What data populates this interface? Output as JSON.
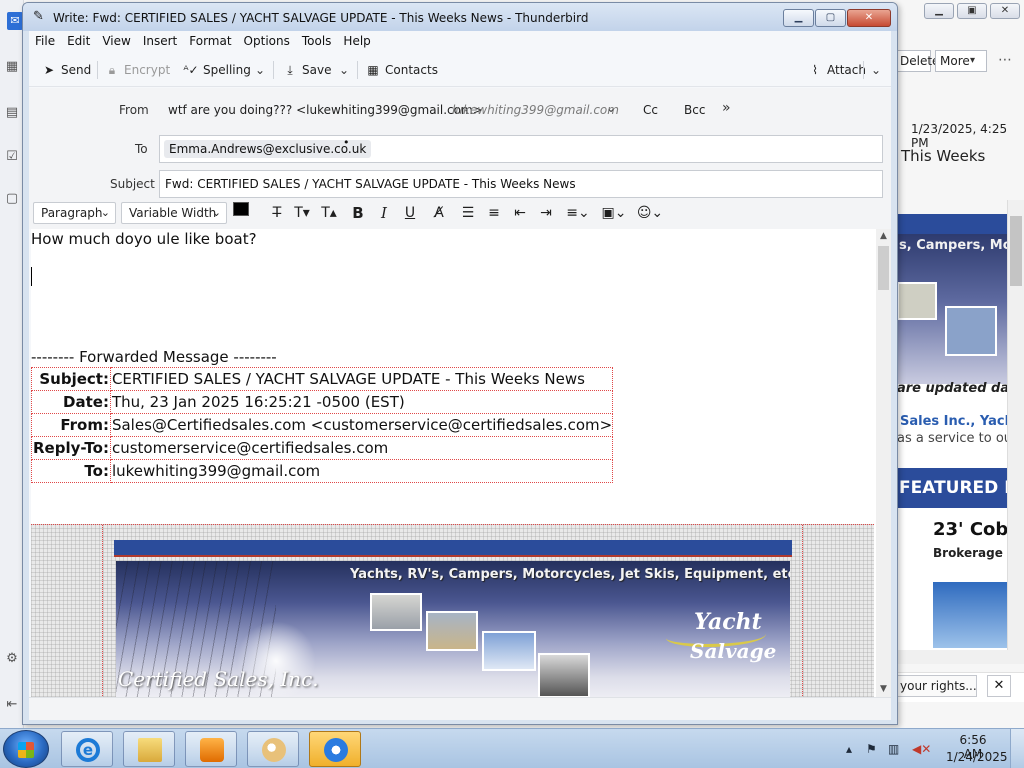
{
  "background_window": {
    "delete_label": "Delete",
    "more_label": "More",
    "date": "1/23/2025, 4:25 PM",
    "subject_fragment": "This Weeks",
    "preview": {
      "caption_fragment": "s, Campers, Moto",
      "updated_fragment": "are updated daily",
      "sales_fragment": "Sales Inc., Yach",
      "service_fragment": "as a service to our",
      "featured_fragment": "FEATURED IT",
      "listing_title_fragment": "23' Coba",
      "listing_type_fragment": "Brokerage -"
    },
    "notification_button": "your rights...",
    "notification_close": "✕"
  },
  "compose": {
    "title": "Write: Fwd: CERTIFIED SALES / YACHT SALVAGE UPDATE - This Weeks News - Thunderbird",
    "menu": [
      "File",
      "Edit",
      "View",
      "Insert",
      "Format",
      "Options",
      "Tools",
      "Help"
    ],
    "toolbar": {
      "send": "Send",
      "encrypt": "Encrypt",
      "spelling": "Spelling",
      "save": "Save",
      "contacts": "Contacts",
      "attach": "Attach"
    },
    "headers": {
      "from_label": "From",
      "from_value": "wtf are you doing??? <lukewhiting399@gmail.com>",
      "from_identity": "lukewhiting399@gmail.com",
      "cc": "Cc",
      "bcc": "Bcc",
      "more_fields": "»",
      "to_label": "To",
      "to_recipient": "Emma.Andrews@exclusive.co.uk",
      "subject_label": "Subject",
      "subject_value": "Fwd: CERTIFIED SALES / YACHT SALVAGE UPDATE - This Weeks News"
    },
    "format": {
      "paragraph": "Paragraph",
      "font": "Variable Width",
      "text_color": "#000000",
      "background_color": "#ffffff"
    },
    "body": {
      "first_line": "How much doyo ule like boat?",
      "forward_separator": "-------- Forwarded Message --------",
      "forward_headers": [
        {
          "key": "Subject:",
          "value": "CERTIFIED SALES / YACHT SALVAGE UPDATE - This Weeks News"
        },
        {
          "key": "Date:",
          "value": "Thu, 23 Jan 2025 16:25:21 -0500 (EST)"
        },
        {
          "key": "From:",
          "value": "Sales@Certifiedsales.com <customerservice@certifiedsales.com>"
        },
        {
          "key": "Reply-To:",
          "value": "customerservice@certifiedsales.com"
        },
        {
          "key": "To:",
          "value": "lukewhiting399@gmail.com"
        }
      ],
      "newsletter": {
        "caption": "Yachts, RV's, Campers, Motorcycles, Jet Skis, Equipment, etc.",
        "logo_line1": "Yacht",
        "logo_line2": "Salvage",
        "company": "Certified Sales, Inc."
      }
    }
  },
  "taskbar": {
    "time": "6:56 AM",
    "date": "1/24/2025"
  },
  "colors": {
    "accent_blue": "#2b4c9b",
    "title_bar": "#c2d3ea",
    "close_button": "#c74a32"
  }
}
